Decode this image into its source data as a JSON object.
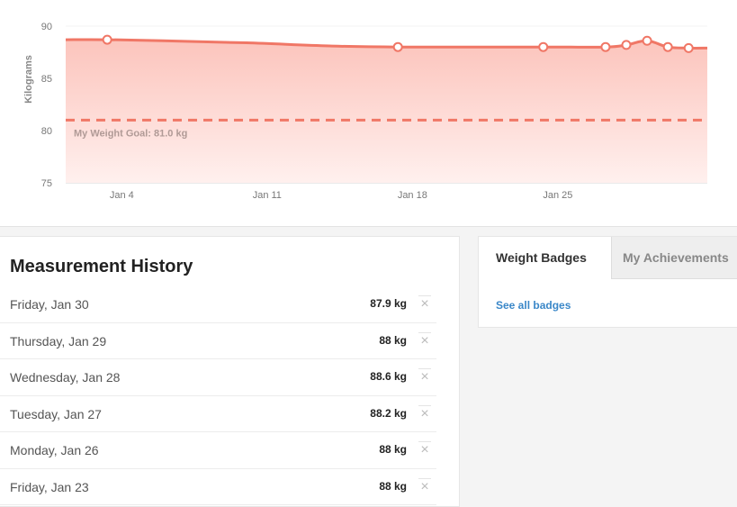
{
  "chart_data": {
    "type": "area",
    "ylabel": "Kilograms",
    "ylim": [
      75,
      90
    ],
    "y_ticks": [
      "75",
      "80",
      "85",
      "90"
    ],
    "x_ticks": [
      {
        "label": "Jan 4",
        "day": 4
      },
      {
        "label": "Jan 11",
        "day": 11
      },
      {
        "label": "Jan 18",
        "day": 18
      },
      {
        "label": "Jan 25",
        "day": 25
      }
    ],
    "x_range_days": [
      1.3,
      32.2
    ],
    "series": [
      {
        "points": [
          {
            "day": 1.3,
            "value": 88.7
          },
          {
            "day": 3.3,
            "value": 88.7
          },
          {
            "day": 6.0,
            "value": 88.6
          },
          {
            "day": 10.0,
            "value": 88.4
          },
          {
            "day": 14.0,
            "value": 88.1
          },
          {
            "day": 17.3,
            "value": 88.0
          },
          {
            "day": 24.3,
            "value": 88.0
          },
          {
            "day": 27.3,
            "value": 88.0
          },
          {
            "day": 28.3,
            "value": 88.2
          },
          {
            "day": 29.3,
            "value": 88.6
          },
          {
            "day": 30.3,
            "value": 88.0
          },
          {
            "day": 31.3,
            "value": 87.9
          },
          {
            "day": 32.2,
            "value": 87.9
          }
        ],
        "markers": [
          {
            "day": 3.3,
            "value": 88.7
          },
          {
            "day": 17.3,
            "value": 88.0
          },
          {
            "day": 24.3,
            "value": 88.0
          },
          {
            "day": 27.3,
            "value": 88.0
          },
          {
            "day": 28.3,
            "value": 88.2
          },
          {
            "day": 29.3,
            "value": 88.6
          },
          {
            "day": 30.3,
            "value": 88.0
          },
          {
            "day": 31.3,
            "value": 87.9
          }
        ]
      }
    ],
    "goal": {
      "value": 81.0,
      "label": "My Weight Goal: 81.0 kg"
    },
    "colors": {
      "line": "#f07766",
      "fill_top": "#fcc4bc",
      "fill_bottom": "#fff0ee",
      "goal": "#f07766"
    }
  },
  "history": {
    "title": "Measurement History",
    "delete_glyph": "×",
    "rows": [
      {
        "date": "Friday, Jan 30",
        "value": "87.9 kg"
      },
      {
        "date": "Thursday, Jan 29",
        "value": "88 kg"
      },
      {
        "date": "Wednesday, Jan 28",
        "value": "88.6 kg"
      },
      {
        "date": "Tuesday, Jan 27",
        "value": "88.2 kg"
      },
      {
        "date": "Monday, Jan 26",
        "value": "88 kg"
      },
      {
        "date": "Friday, Jan 23",
        "value": "88 kg"
      }
    ]
  },
  "badges": {
    "tabs": [
      {
        "label": "Weight Badges",
        "active": true
      },
      {
        "label": "My Achievements",
        "active": false
      }
    ],
    "see_all_label": "See all badges"
  }
}
